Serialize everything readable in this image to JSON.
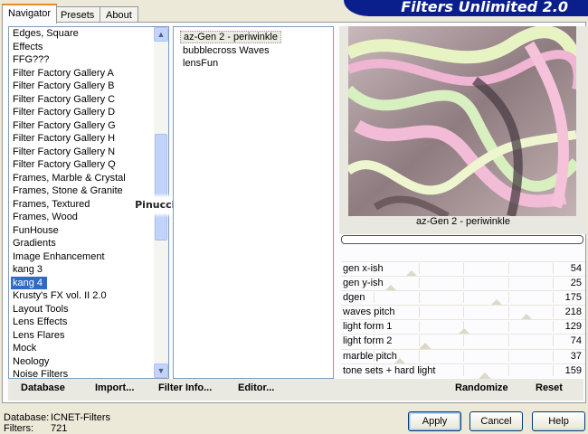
{
  "tabs": [
    "Navigator",
    "Presets",
    "About"
  ],
  "banner": {
    "title": "Filters Unlimited 2.0"
  },
  "categories": [
    "Edges, Square",
    "Effects",
    "FFG???",
    "Filter Factory Gallery A",
    "Filter Factory Gallery B",
    "Filter Factory Gallery C",
    "Filter Factory Gallery D",
    "Filter Factory Gallery G",
    "Filter Factory Gallery H",
    "Filter Factory Gallery N",
    "Filter Factory Gallery Q",
    "Frames, Marble & Crystal",
    "Frames, Stone & Granite",
    "Frames, Textured",
    "Frames, Wood",
    "FunHouse",
    "Gradients",
    "Image Enhancement",
    "kang 3",
    "kang 4",
    "Krusty's FX vol. II 2.0",
    "Layout Tools",
    "Lens Effects",
    "Lens Flares",
    "Mock",
    "Neology",
    "Noise Filters"
  ],
  "selected_category": "kang 4",
  "filters": [
    "az-Gen 2  -  periwinkle",
    "bubblecross Waves",
    "lensFun"
  ],
  "watermark": "Pinuccia",
  "preview": {
    "title": "az-Gen 2  -  periwinkle",
    "progress": 0
  },
  "params": [
    {
      "label": "gen x-ish",
      "value": "54"
    },
    {
      "label": "gen y-ish",
      "value": "25"
    },
    {
      "label": "dgen",
      "value": "175"
    },
    {
      "label": "waves pitch",
      "value": "218"
    },
    {
      "label": "light form 1",
      "value": "129"
    },
    {
      "label": "light form 2",
      "value": "74"
    },
    {
      "label": "marble pitch",
      "value": "37"
    },
    {
      "label": "tone sets + hard light",
      "value": "159"
    }
  ],
  "bottom_buttons": {
    "database": "Database",
    "import": "Import...",
    "filter_info": "Filter Info...",
    "editor": "Editor...",
    "randomize": "Randomize",
    "reset": "Reset"
  },
  "status": {
    "database_label": "Database:",
    "database_value": "ICNET-Filters",
    "filters_label": "Filters:",
    "filters_value": "721"
  },
  "dialog_buttons": {
    "apply": "Apply",
    "cancel": "Cancel",
    "help": "Help"
  },
  "colors": {
    "selection": "#316ac5",
    "banner": "#0a1e8c",
    "tab_highlight": "#e68b2c"
  },
  "icons": {
    "scroll_up": "triangle-up-icon",
    "scroll_down": "triangle-down-icon"
  }
}
